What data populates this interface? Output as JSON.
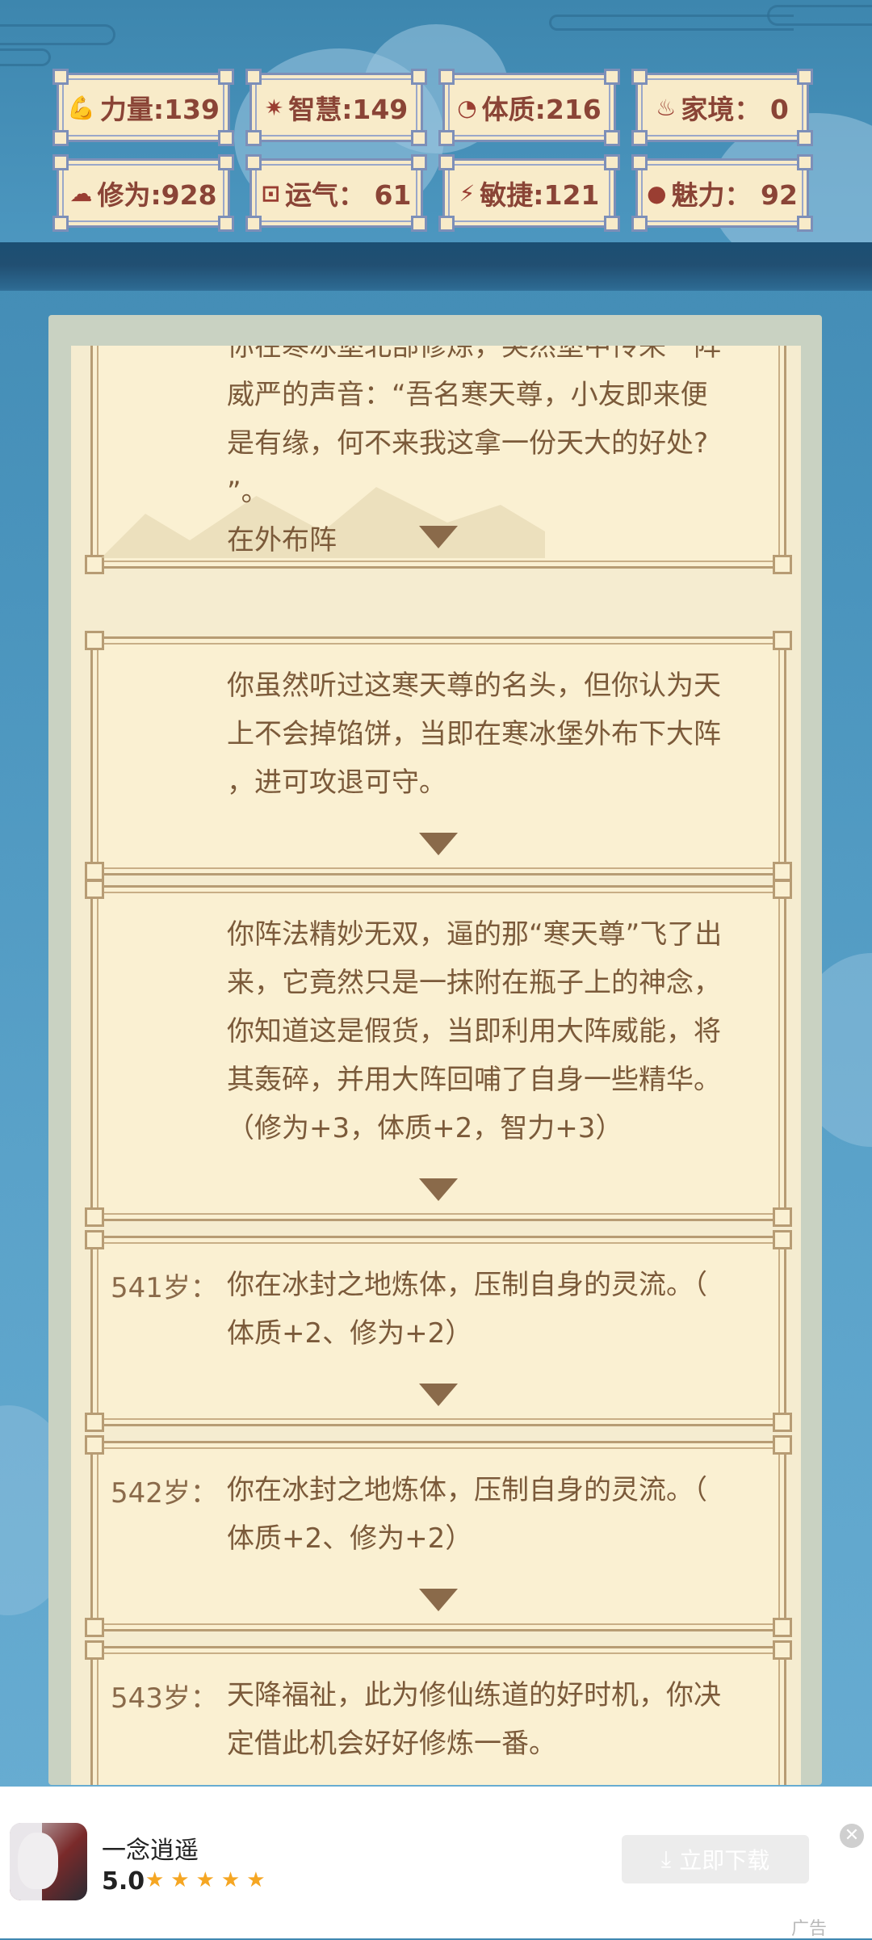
{
  "stats": [
    {
      "icon": "arm-icon",
      "symbol": "💪",
      "label": "力量:139"
    },
    {
      "icon": "bulb-icon",
      "symbol": "✷",
      "label": "智慧:149"
    },
    {
      "icon": "body-icon",
      "symbol": "◔",
      "label": "体质:216"
    },
    {
      "icon": "family-icon",
      "symbol": "♨",
      "label": "家境： 0"
    },
    {
      "icon": "cloud-icon",
      "symbol": "☁",
      "label": "修为:928"
    },
    {
      "icon": "luck-icon",
      "symbol": "⊡",
      "label": "运气： 61"
    },
    {
      "icon": "lightning-icon",
      "symbol": "⚡",
      "label": "敏捷:121"
    },
    {
      "icon": "charm-icon",
      "symbol": "●",
      "label": "魅力： 92"
    }
  ],
  "events": [
    {
      "age": "",
      "lines": [
        "你在寒冰堡北部修炼，突然堡中传来一阵",
        "威严的声音：“吾名寒天尊，小友即来便",
        "是有缘，何不来我这拿一份天大的好处?",
        "”。",
        "在外布阵"
      ]
    },
    {
      "age": "",
      "lines": [
        "你虽然听过这寒天尊的名头，但你认为天",
        "上不会掉馅饼，当即在寒冰堡外布下大阵",
        "，进可攻退可守。"
      ]
    },
    {
      "age": "",
      "lines": [
        "你阵法精妙无双，逼的那“寒天尊”飞了出",
        "来，它竟然只是一抹附在瓶子上的神念，",
        "你知道这是假货，当即利用大阵威能，将",
        "其轰碎，并用大阵回哺了自身一些精华。",
        "（修为+3，体质+2，智力+3）"
      ]
    },
    {
      "age": "541岁：",
      "lines": [
        "你在冰封之地炼体，压制自身的灵流。（",
        "体质+2、修为+2）"
      ]
    },
    {
      "age": "542岁：",
      "lines": [
        "你在冰封之地炼体，压制自身的灵流。（",
        "体质+2、修为+2）"
      ]
    },
    {
      "age": "543岁：",
      "lines": [
        "天降福祉，此为修仙练道的好时机，你决",
        "定借此机会好好修炼一番。"
      ]
    }
  ],
  "ad": {
    "app_name": "一念逍遥",
    "rating": "5.0",
    "stars": "★★★★★",
    "download_label": "立即下载",
    "download_icon": "⤓",
    "close_icon": "✕",
    "tag": "广告"
  }
}
